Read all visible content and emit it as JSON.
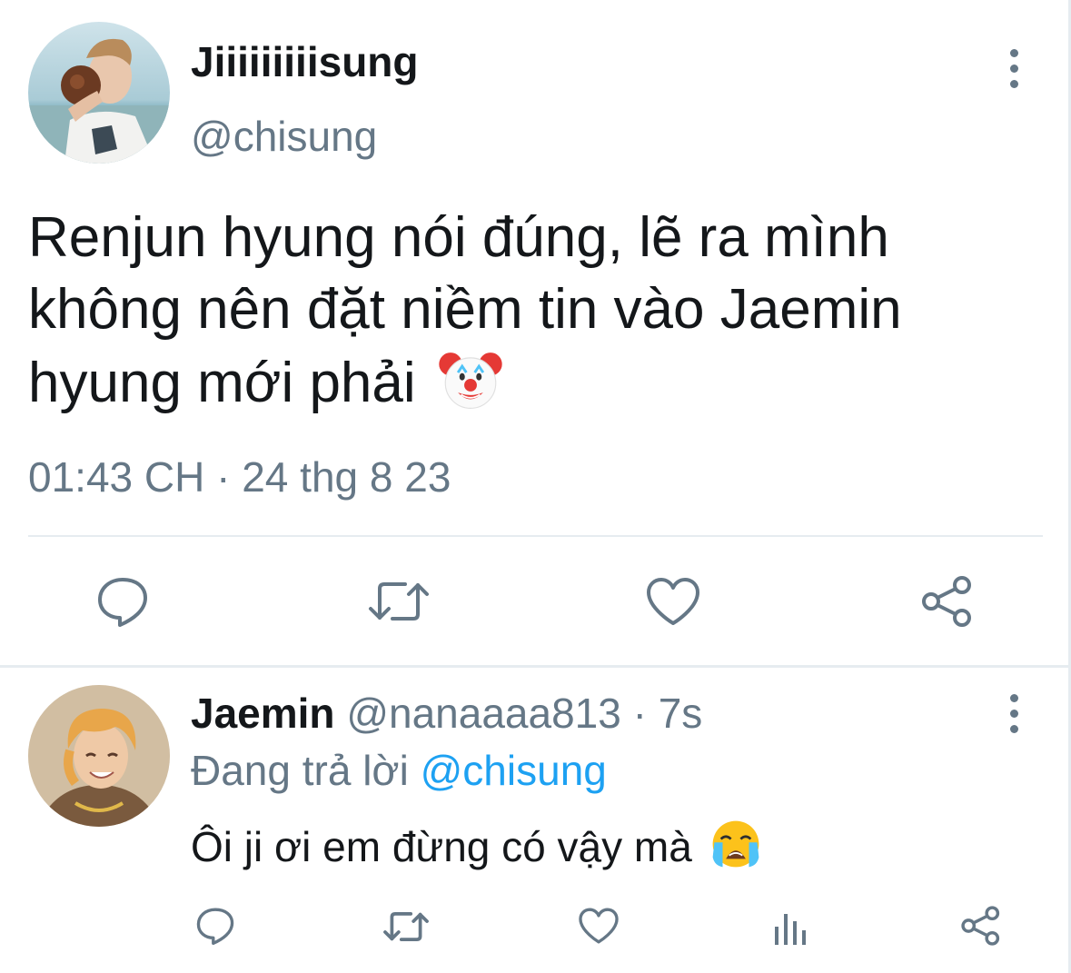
{
  "main_tweet": {
    "display_name": "Jiiiiiiiiisung",
    "handle": "@chisung",
    "text": "Renjun hyung nói đúng, lẽ ra mình không nên đặt niềm tin vào Jaemin hyung mới phải",
    "emoji": "clown-face-icon",
    "timestamp": "01:43 CH · 24 thg 8 23",
    "actions": [
      "reply-icon",
      "retweet-icon",
      "like-icon",
      "share-icon"
    ]
  },
  "reply": {
    "display_name": "Jaemin",
    "handle_time": "@nanaaaa813 · 7s",
    "replying_prefix": "Đang trả lời",
    "replying_to": "@chisung",
    "text": "Ôi ji ơi em đừng có vậy mà",
    "emoji": "loudly-crying-face-icon",
    "actions": [
      "reply-icon",
      "retweet-icon",
      "like-icon",
      "analytics-icon",
      "share-icon"
    ]
  },
  "colors": {
    "text_primary": "#14171a",
    "text_secondary": "#657786",
    "link": "#1da1f2",
    "divider": "#e6ecf0"
  }
}
